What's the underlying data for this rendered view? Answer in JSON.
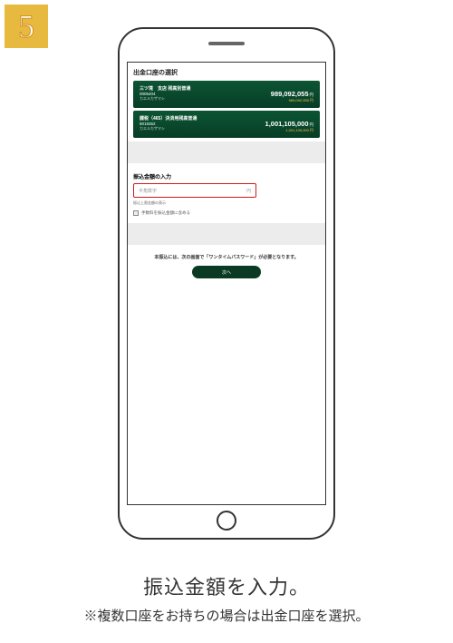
{
  "step_number": "5",
  "screen": {
    "title": "出金口座の選択",
    "accounts": [
      {
        "name": "三ツ境　支店 残高別普通",
        "number": "0005404",
        "sub": "カエルカザマシ",
        "amount": "989,092,055",
        "unit": "円",
        "amount_sub": "989,092,055 円"
      },
      {
        "name": "課税（465）決済用残高普通",
        "number": "9018362",
        "sub": "カエルカザマシ",
        "amount": "1,001,105,000",
        "unit": "円",
        "amount_sub": "1,001,105,000 円"
      }
    ],
    "input_section_label": "振込金額の入力",
    "input_placeholder": "半角数字",
    "input_unit": "円",
    "input_note": "振込上限金額の表示",
    "checkbox_label": "手数料を振込金額に含める",
    "notice": "本振込には、次の画面で「ワンタイムパスワード」が必要となります。",
    "next_button": "次へ"
  },
  "caption": {
    "main": "振込金額を入力。",
    "sub": "※複数口座をお持ちの場合は出金口座を選択。"
  }
}
